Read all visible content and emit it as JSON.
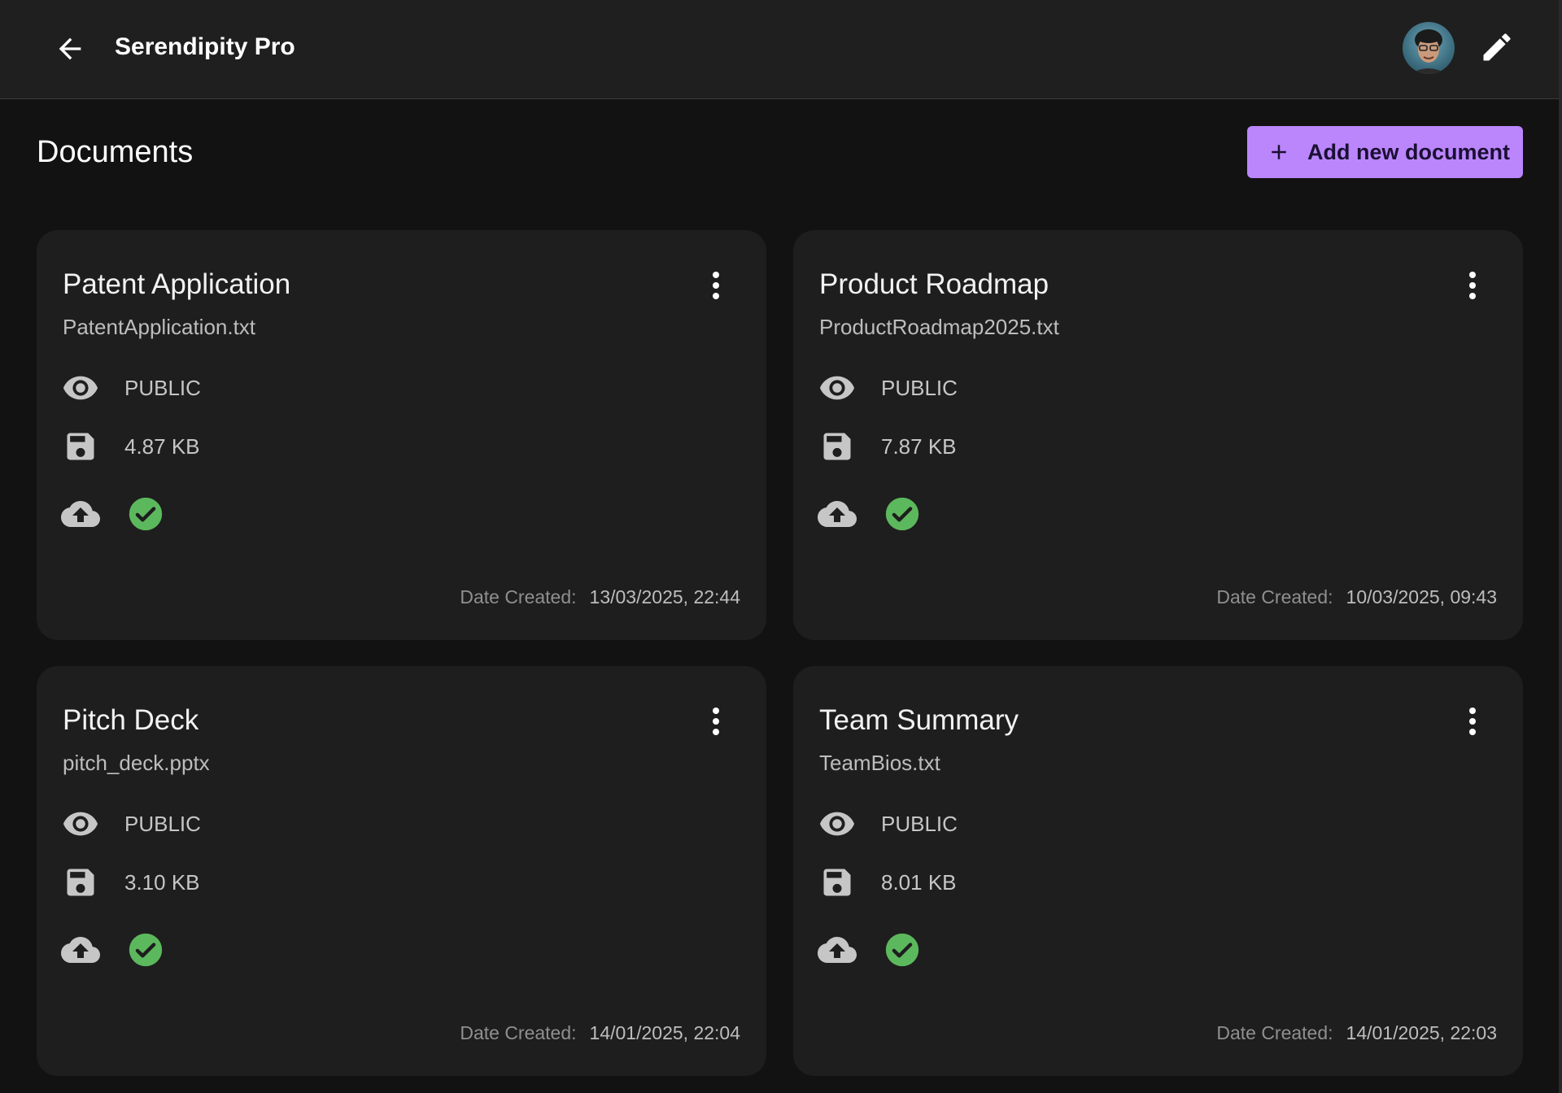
{
  "app": {
    "title": "Serendipity Pro"
  },
  "page": {
    "title": "Documents",
    "add_label": "Add new document"
  },
  "labels": {
    "date_created": "Date Created:"
  },
  "icons": {
    "back": "arrow-left-icon",
    "edit": "pencil-icon",
    "add": "plus-icon",
    "more": "more-vertical-icon",
    "visibility": "eye-icon",
    "size": "floppy-disk-icon",
    "upload": "cloud-upload-icon",
    "status": "check-circle-icon"
  },
  "colors": {
    "accent": "#bb86fc",
    "success": "#5cb85c",
    "card_bg": "#1e1e1e",
    "page_bg": "#121212",
    "topbar_bg": "#1f1f1f"
  },
  "documents": [
    {
      "title": "Patent Application",
      "filename": "PatentApplication.txt",
      "visibility": "PUBLIC",
      "size": "4.87 KB",
      "date": "13/03/2025, 22:44"
    },
    {
      "title": "Product Roadmap",
      "filename": "ProductRoadmap2025.txt",
      "visibility": "PUBLIC",
      "size": "7.87 KB",
      "date": "10/03/2025, 09:43"
    },
    {
      "title": "Pitch Deck",
      "filename": "pitch_deck.pptx",
      "visibility": "PUBLIC",
      "size": "3.10 KB",
      "date": "14/01/2025, 22:04"
    },
    {
      "title": "Team Summary",
      "filename": "TeamBios.txt",
      "visibility": "PUBLIC",
      "size": "8.01 KB",
      "date": "14/01/2025, 22:03"
    }
  ]
}
